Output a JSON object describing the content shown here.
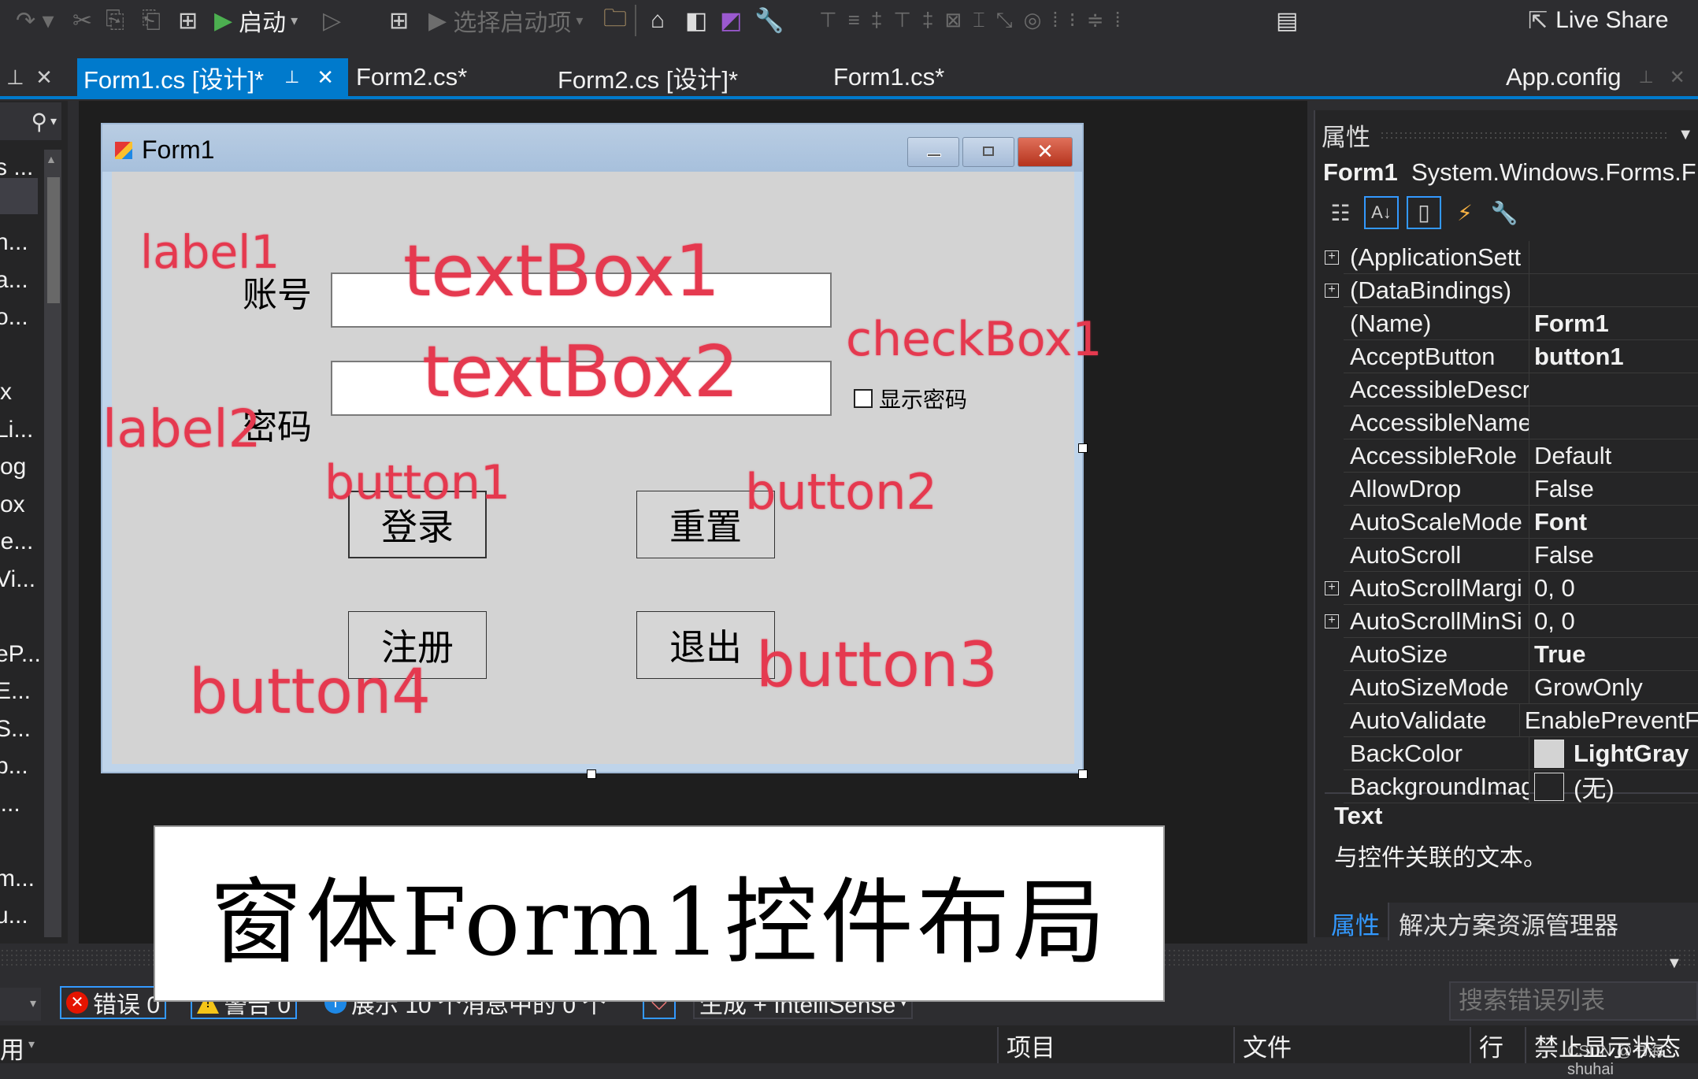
{
  "toolbar": {
    "start_label": "启动",
    "startup_item_label": "选择启动项",
    "live_share_label": "Live Share"
  },
  "tabs": [
    {
      "label": "Form1.cs [设计]*",
      "active": true,
      "pinned": true
    },
    {
      "label": "Form2.cs*",
      "active": false
    },
    {
      "label": "Form2.cs [设计]*",
      "active": false
    },
    {
      "label": "Form1.cs*",
      "active": false
    },
    {
      "label": "App.config",
      "active": false
    }
  ],
  "left_panel": {
    "items": [
      "s ...",
      "",
      "n...",
      "a...",
      "o...",
      "",
      "x",
      "Li...",
      "og",
      "ox",
      "le...",
      "Vi...",
      "",
      "eP...",
      "E...",
      "S...",
      "p...",
      "i...",
      "",
      "m...",
      "u..."
    ]
  },
  "form": {
    "title": "Form1",
    "label1_text": "账号",
    "label2_text": "密码",
    "checkbox_text": "显示密码",
    "checkbox_checked": false,
    "button1_text": "登录",
    "button2_text": "重置",
    "button3_text": "退出",
    "button4_text": "注册",
    "textbox1_value": "",
    "textbox2_value": ""
  },
  "annotations": {
    "label1": "label1",
    "label2": "label2",
    "textBox1": "textBox1",
    "textBox2": "textBox2",
    "checkBox1": "checkBox1",
    "button1": "button1",
    "button2": "button2",
    "button3": "button3",
    "button4": "button4",
    "color": "#e5394f"
  },
  "caption": "窗体Form1控件布局",
  "properties": {
    "panel_title": "属性",
    "object_name": "Form1",
    "object_type": "System.Windows.Forms.F",
    "rows": [
      {
        "name": "(ApplicationSett",
        "value": "",
        "expandable": true
      },
      {
        "name": "(DataBindings)",
        "value": "",
        "expandable": true
      },
      {
        "name": "(Name)",
        "value": "Form1",
        "bold": true
      },
      {
        "name": "AcceptButton",
        "value": "button1",
        "bold": true
      },
      {
        "name": "AccessibleDescr",
        "value": ""
      },
      {
        "name": "AccessibleName",
        "value": ""
      },
      {
        "name": "AccessibleRole",
        "value": "Default"
      },
      {
        "name": "AllowDrop",
        "value": "False"
      },
      {
        "name": "AutoScaleMode",
        "value": "Font",
        "bold": true
      },
      {
        "name": "AutoScroll",
        "value": "False"
      },
      {
        "name": "AutoScrollMargi",
        "value": "0, 0",
        "expandable": true
      },
      {
        "name": "AutoScrollMinSi",
        "value": "0, 0",
        "expandable": true
      },
      {
        "name": "AutoSize",
        "value": "True",
        "bold": true
      },
      {
        "name": "AutoSizeMode",
        "value": "GrowOnly"
      },
      {
        "name": "AutoValidate",
        "value": "EnablePreventF"
      },
      {
        "name": "BackColor",
        "value": "LightGray",
        "bold": true,
        "swatch": "#d3d3d3"
      },
      {
        "name": "BackgroundImag",
        "value": "(无)",
        "swatch": "#252526"
      }
    ],
    "desc_title": "Text",
    "desc_text": "与控件关联的文本。",
    "bottom_tabs": [
      {
        "label": "属性",
        "active": true
      },
      {
        "label": "解决方案资源管理器",
        "active": false
      }
    ]
  },
  "error_list": {
    "errors_label": "错误 0",
    "warnings_label": "警告 0",
    "messages_label": "展示 10 个消息中的 0 个",
    "build_filter": "生成 + IntelliSense",
    "search_placeholder": "搜索错误列表",
    "scope_label": "用",
    "columns": [
      "项目",
      "文件",
      "行",
      "禁止显示状态"
    ]
  },
  "watermark": "CSDN @书海shuhai"
}
